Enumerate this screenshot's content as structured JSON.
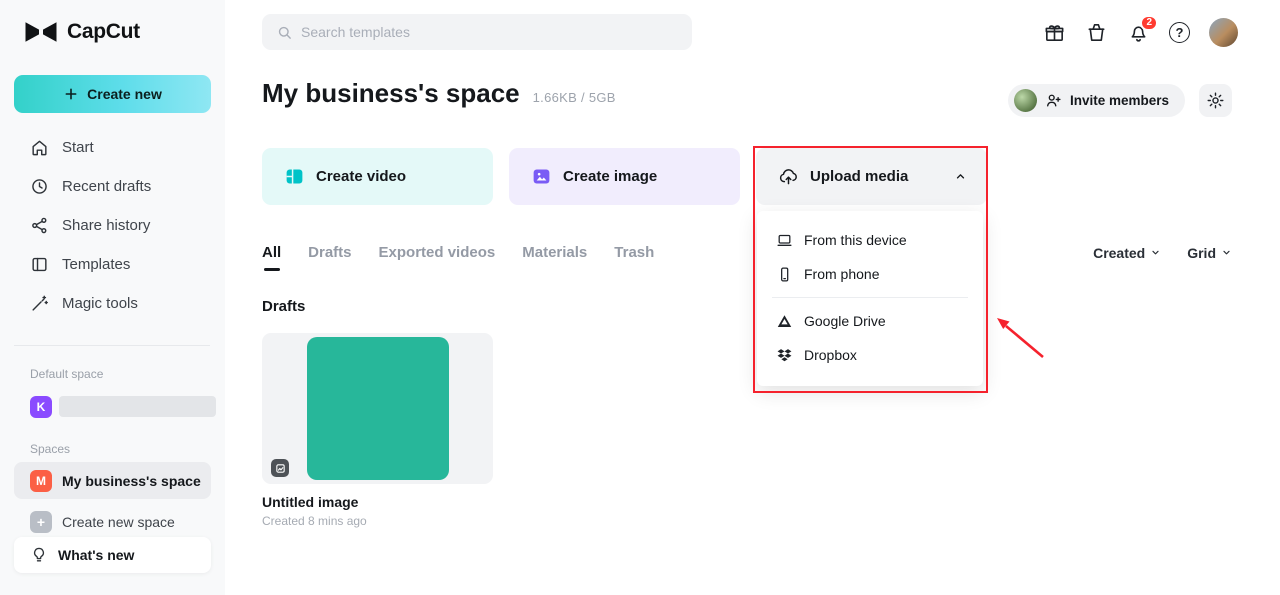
{
  "brand": {
    "name": "CapCut"
  },
  "sidebar": {
    "create_new": "Create new",
    "items": [
      {
        "label": "Start",
        "icon": "home-icon"
      },
      {
        "label": "Recent drafts",
        "icon": "clock-icon"
      },
      {
        "label": "Share history",
        "icon": "share-icon"
      },
      {
        "label": "Templates",
        "icon": "templates-icon"
      },
      {
        "label": "Magic tools",
        "icon": "magic-wand-icon"
      }
    ],
    "default_space_label": "Default space",
    "default_space_initial": "K",
    "spaces_label": "Spaces",
    "current_space": {
      "initial": "M",
      "label": "My business's space"
    },
    "create_new_space": "Create new space",
    "whats_new": "What's new"
  },
  "topbar": {
    "search_placeholder": "Search templates",
    "notification_count": "2"
  },
  "header": {
    "title": "My business's space",
    "storage": "1.66KB / 5GB",
    "invite_members": "Invite members"
  },
  "actions": {
    "create_video": "Create video",
    "create_image": "Create image",
    "upload_media": "Upload media"
  },
  "upload_menu": {
    "items": [
      {
        "label": "From this device",
        "icon": "device-icon"
      },
      {
        "label": "From phone",
        "icon": "phone-icon"
      },
      {
        "label": "Google Drive",
        "icon": "google-drive-icon"
      },
      {
        "label": "Dropbox",
        "icon": "dropbox-icon"
      }
    ]
  },
  "tabs": [
    {
      "label": "All",
      "active": true
    },
    {
      "label": "Drafts",
      "active": false
    },
    {
      "label": "Exported videos",
      "active": false
    },
    {
      "label": "Materials",
      "active": false
    },
    {
      "label": "Trash",
      "active": false
    }
  ],
  "filters": {
    "sort": "Created",
    "view": "Grid"
  },
  "content": {
    "section_title": "Drafts",
    "cards": [
      {
        "title": "Untitled image",
        "subtitle": "Created 8 mins ago"
      }
    ]
  },
  "glyphs": {
    "plus": "+",
    "question": "?"
  },
  "colors": {
    "accent_teal": "#00c3c8",
    "accent_purple": "#7a5cf5",
    "thumbnail_teal": "#27b79a",
    "annotation_red": "#f5222d",
    "badge_red": "#ff3b30",
    "space_purple": "#8a4bff",
    "space_orange": "#fb5f45"
  }
}
